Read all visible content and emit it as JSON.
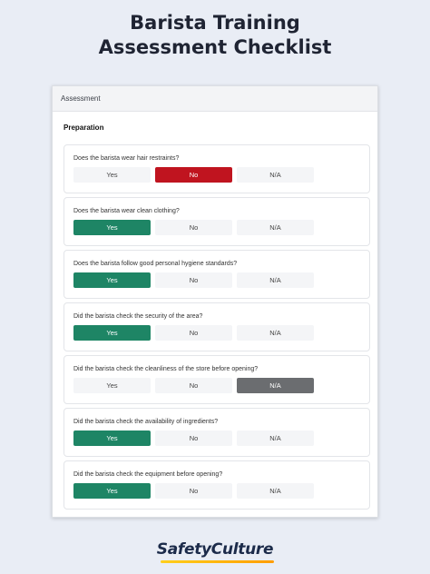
{
  "page": {
    "title_line1": "Barista Training",
    "title_line2": "Assessment Checklist"
  },
  "card": {
    "header": "Assessment",
    "section_title": "Preparation"
  },
  "options": [
    "Yes",
    "No",
    "N/A"
  ],
  "questions": [
    {
      "text": "Does the barista wear hair restraints?",
      "selected": "No"
    },
    {
      "text": "Does the barista wear clean clothing?",
      "selected": "Yes"
    },
    {
      "text": "Does the barista follow good personal hygiene standards?",
      "selected": "Yes"
    },
    {
      "text": "Did the barista check the security of the area?",
      "selected": "Yes"
    },
    {
      "text": "Did the barista check the cleanliness of the store before opening?",
      "selected": "N/A"
    },
    {
      "text": "Did the barista check the availability of ingredients?",
      "selected": "Yes"
    },
    {
      "text": "Did the barista check the equipment before opening?",
      "selected": "Yes"
    }
  ],
  "colors": {
    "yes": "#1e8565",
    "no": "#c0141f",
    "na": "#6b6d70",
    "unselected": "#f4f5f7"
  },
  "brand": {
    "logo_text": "SafetyCulture",
    "logo_icon": "underline-swoosh"
  }
}
